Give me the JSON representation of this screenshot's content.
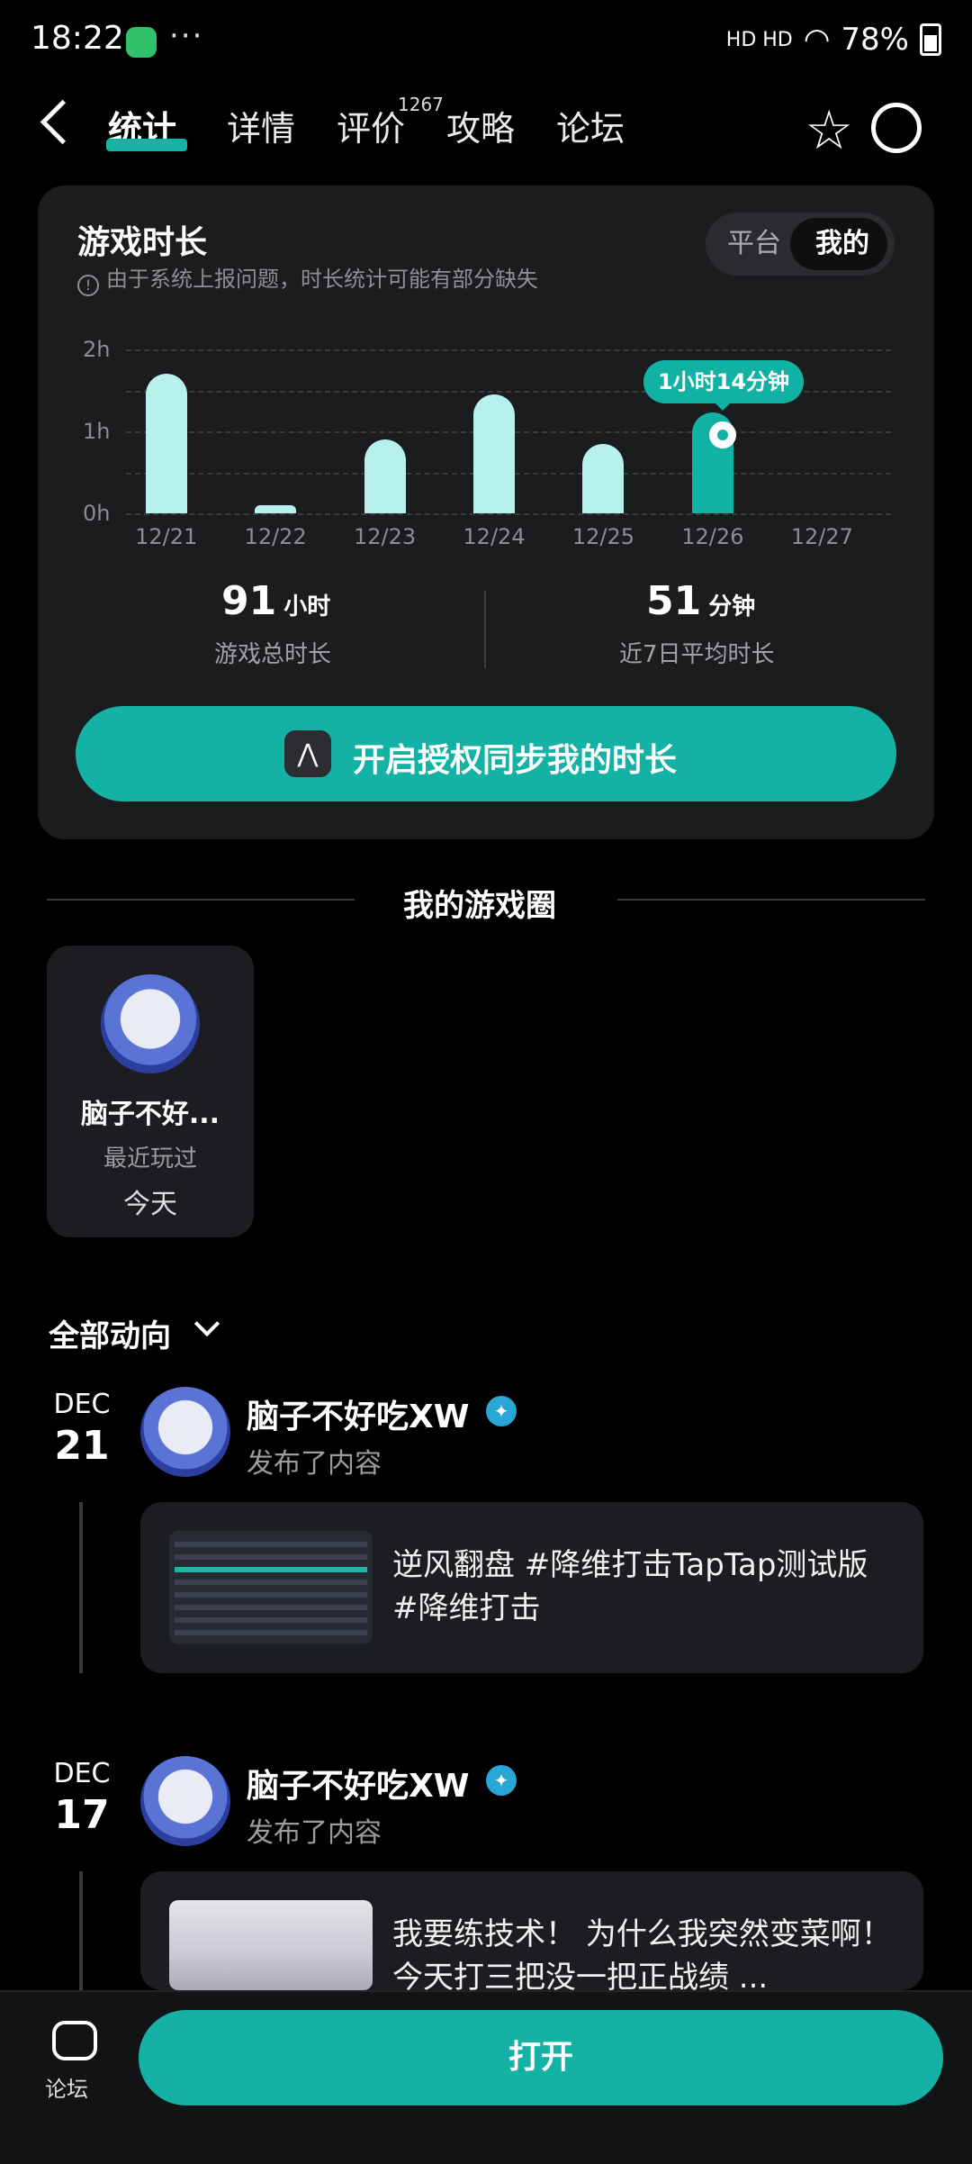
{
  "status_bar": {
    "time": "18:22",
    "more": "···",
    "signal": "HD HD",
    "battery": "78%"
  },
  "nav": {
    "tabs": [
      {
        "label": "统计"
      },
      {
        "label": "详情"
      },
      {
        "label": "评价"
      },
      {
        "label": "攻略"
      },
      {
        "label": "论坛"
      }
    ],
    "review_count": "1267"
  },
  "stats_card": {
    "title": "游戏时长",
    "note": "由于系统上报问题，时长统计可能有部分缺失",
    "toggle": [
      "平台",
      "我的"
    ],
    "tooltip": "1小时14分钟",
    "total": {
      "value": "91",
      "unit": "小时",
      "label": "游戏总时长"
    },
    "avg": {
      "value": "51",
      "unit": "分钟",
      "label": "近7日平均时长"
    },
    "sync_button": "开启授权同步我的时长"
  },
  "chart_data": {
    "type": "bar",
    "categories": [
      "12/21",
      "12/22",
      "12/23",
      "12/24",
      "12/25",
      "12/26",
      "12/27"
    ],
    "values": [
      1.7,
      0.1,
      0.9,
      1.45,
      0.85,
      1.23,
      0
    ],
    "unit": "hours",
    "y_ticks": [
      "2h",
      "1h",
      "0h"
    ],
    "ylim": [
      0,
      2
    ],
    "highlight_index": 5
  },
  "circle_section": {
    "title": "我的游戏圈",
    "card": {
      "name": "脑子不好...",
      "sub": "最近玩过",
      "when": "今天"
    }
  },
  "feed": {
    "filter": "全部动向",
    "posts": [
      {
        "month": "DEC",
        "day": "21",
        "author": "脑子不好吃XW",
        "action": "发布了内容",
        "text": "逆风翻盘 #降维打击TapTap测试版 #降维打击"
      },
      {
        "month": "DEC",
        "day": "17",
        "author": "脑子不好吃XW",
        "action": "发布了内容",
        "text": "我要练技术！ 为什么我突然变菜啊！ 今天打三把没一把正战绩 ..."
      }
    ]
  },
  "bottom_bar": {
    "forum_label": "论坛",
    "open_button": "打开"
  },
  "colors": {
    "accent": "#13b2a4",
    "bar": "#b6f1ec",
    "card": "#1b1c1e"
  }
}
